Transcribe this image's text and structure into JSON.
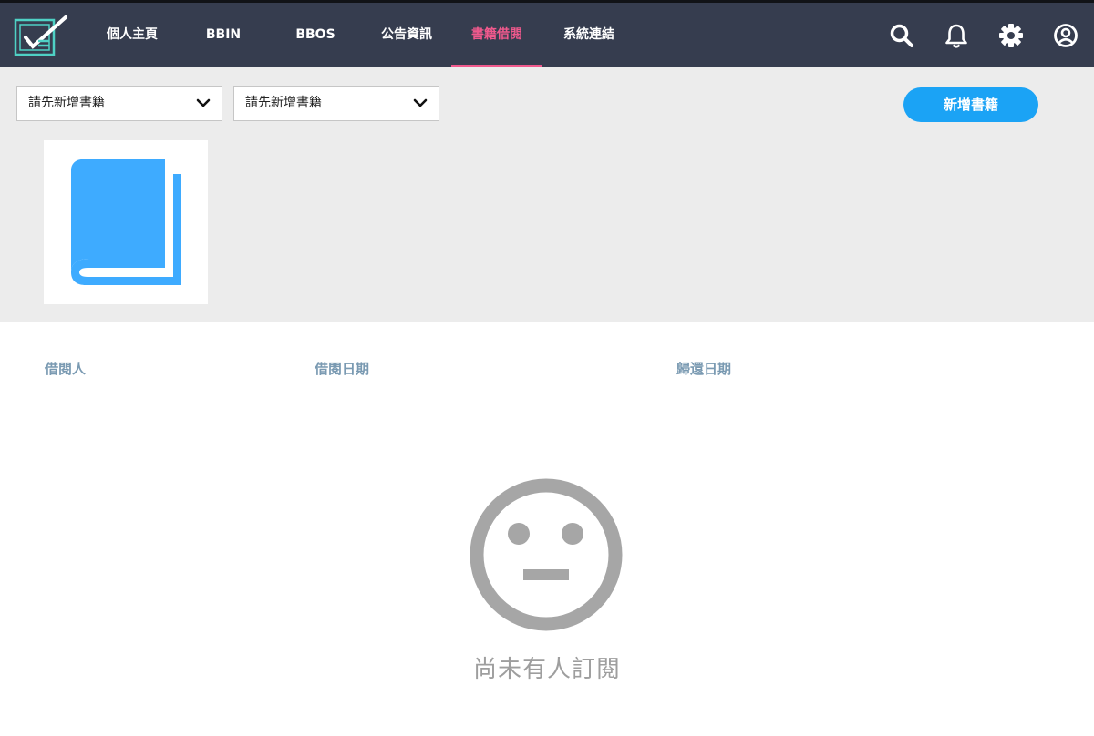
{
  "nav": {
    "items": [
      {
        "label": "個人主頁"
      },
      {
        "label": "BBIN"
      },
      {
        "label": "BBOS"
      },
      {
        "label": "公告資訊"
      },
      {
        "label": "書籍借閱"
      },
      {
        "label": "系統連結"
      }
    ],
    "active_index": 4,
    "icons": [
      "search-icon",
      "bell-icon",
      "gear-icon",
      "user-circle-icon"
    ]
  },
  "toolbar": {
    "select_1": {
      "value": "請先新增書籍"
    },
    "select_2": {
      "value": "請先新增書籍"
    },
    "add_button_label": "新增書籍"
  },
  "table": {
    "headers": [
      "借閱人",
      "借閱日期",
      "歸還日期"
    ]
  },
  "empty_state": {
    "message": "尚未有人訂閱",
    "icon": "neutral-face-icon"
  },
  "colors": {
    "nav_bg": "#363d4f",
    "accent_active": "#f0598d",
    "primary_button": "#1ba3f5",
    "book_icon": "#3eabff",
    "header_text": "#7a9ab2",
    "empty_gray": "#a6a6a6"
  }
}
